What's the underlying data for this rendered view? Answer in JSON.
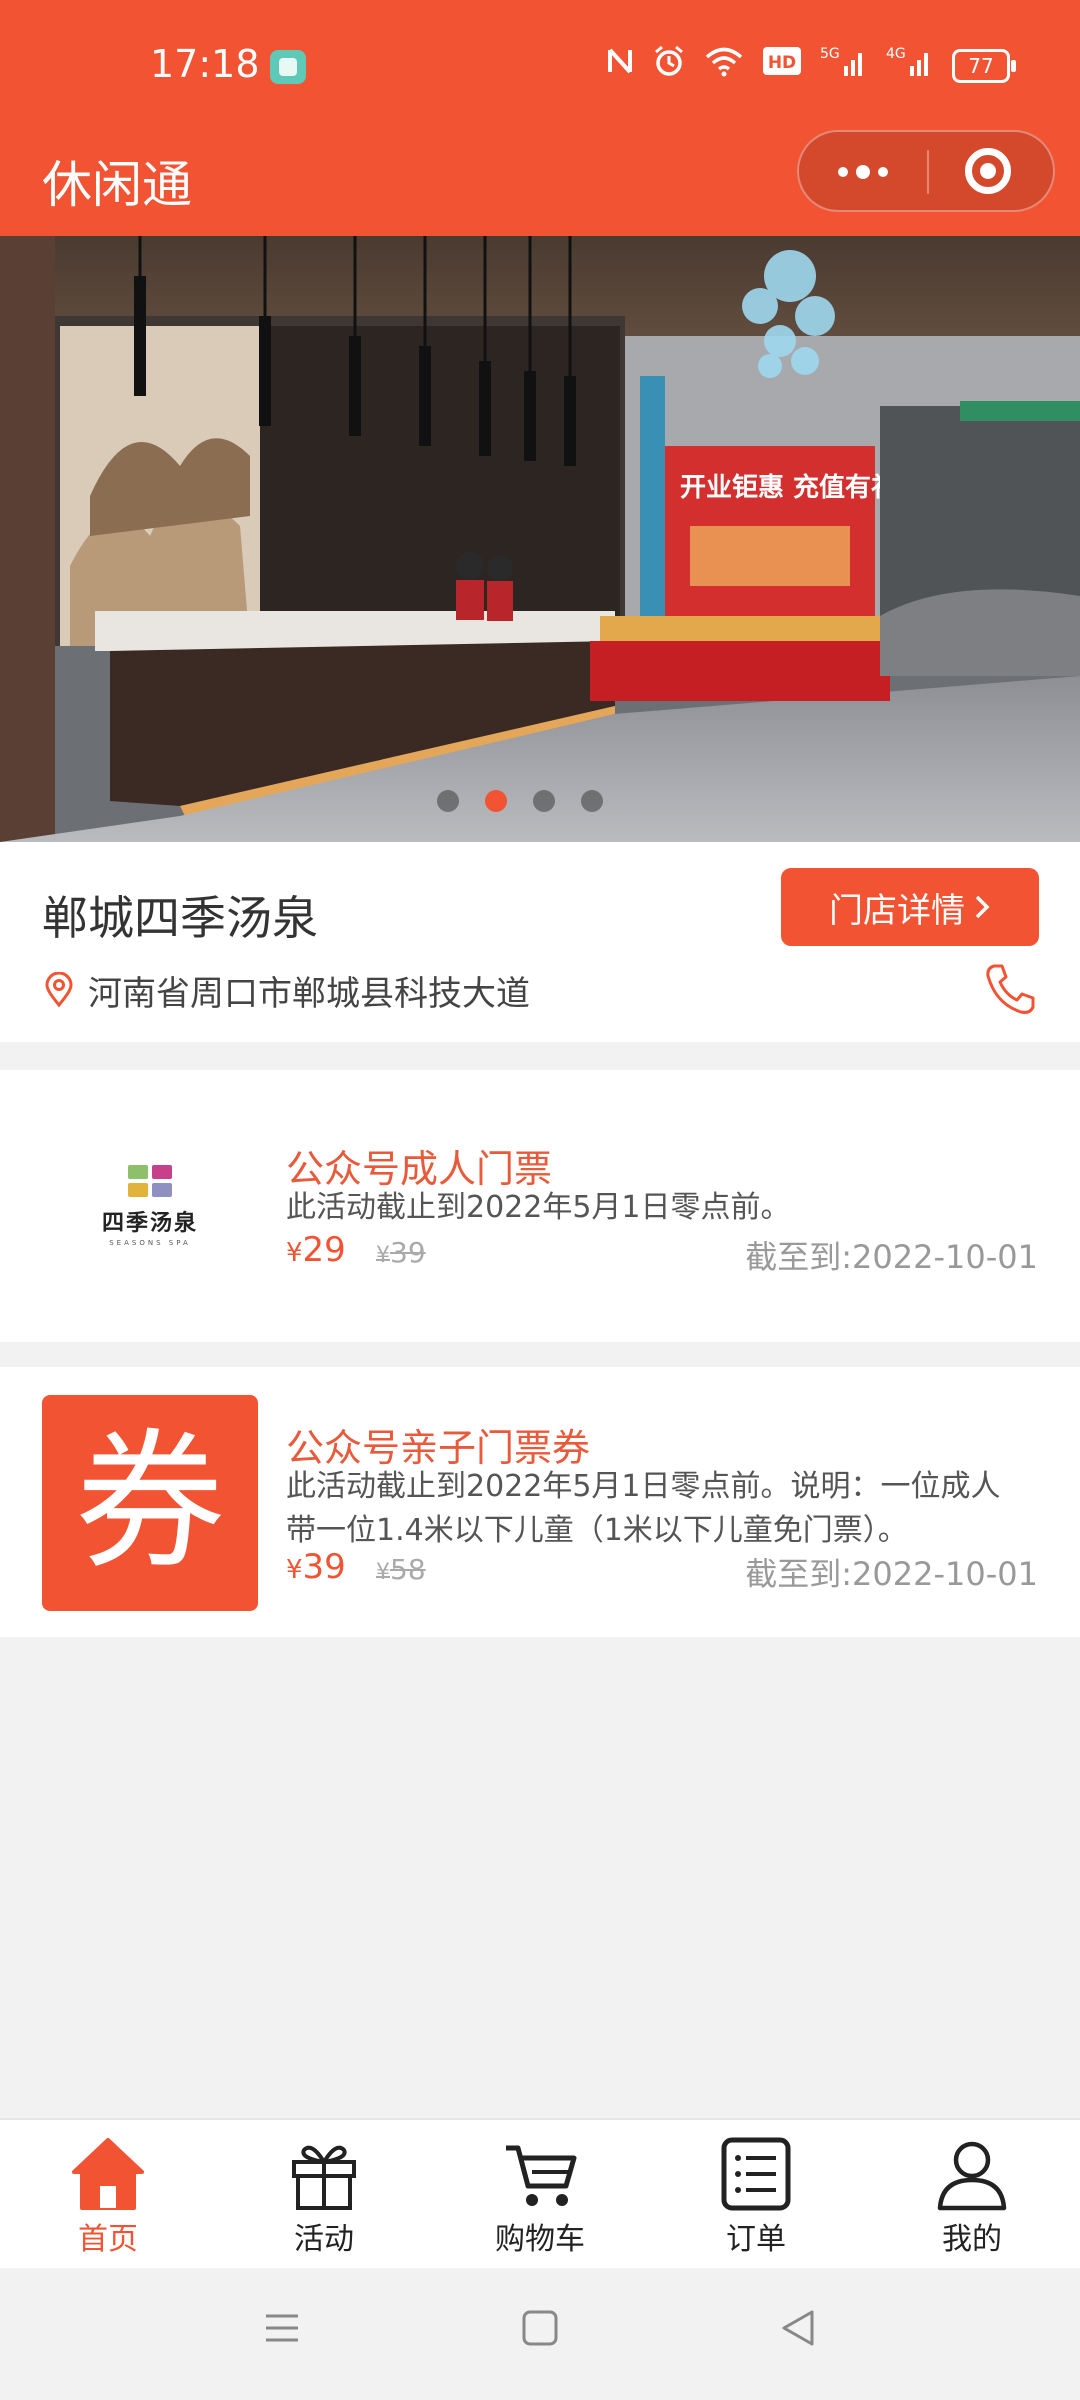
{
  "status_bar": {
    "time": "17:18",
    "battery": "77",
    "icons": [
      "nfc-icon",
      "alarm-icon",
      "wifi-icon",
      "hd-icon",
      "signal-5g-icon",
      "signal-4g-icon",
      "battery-icon"
    ]
  },
  "header": {
    "title": "休闲通",
    "capsule_icons": [
      "more-dots-icon",
      "close-target-icon"
    ]
  },
  "banner": {
    "slide_count": 4,
    "active_index": 1,
    "sign_text": "开业钜惠 充值有礼"
  },
  "store": {
    "name": "郸城四季汤泉",
    "detail_button": "门店详情",
    "address": "河南省周口市郸城县科技大道"
  },
  "items": [
    {
      "title": "公众号成人门票",
      "desc": "此活动截止到2022年5月1日零点前。",
      "currency": "¥",
      "price": "29",
      "original_price": "39",
      "expiry": "截至到:2022-10-01",
      "thumb_logo_cn": "四季汤泉",
      "thumb_logo_en": "SEASONS SPA"
    },
    {
      "title": "公众号亲子门票券",
      "desc": "此活动截止到2022年5月1日零点前。说明：一位成人带一位1.4米以下儿童（1米以下儿童免门票）。",
      "currency": "¥",
      "price": "39",
      "original_price": "58",
      "expiry": "截至到:2022-10-01",
      "thumb_text": "券"
    }
  ],
  "tabbar": [
    {
      "label": "首页",
      "icon": "home-icon",
      "active": true
    },
    {
      "label": "活动",
      "icon": "gift-icon",
      "active": false
    },
    {
      "label": "购物车",
      "icon": "cart-icon",
      "active": false
    },
    {
      "label": "订单",
      "icon": "order-list-icon",
      "active": false
    },
    {
      "label": "我的",
      "icon": "user-icon",
      "active": false
    }
  ],
  "colors": {
    "brand": "#f25433",
    "background": "#f2f2f2"
  }
}
